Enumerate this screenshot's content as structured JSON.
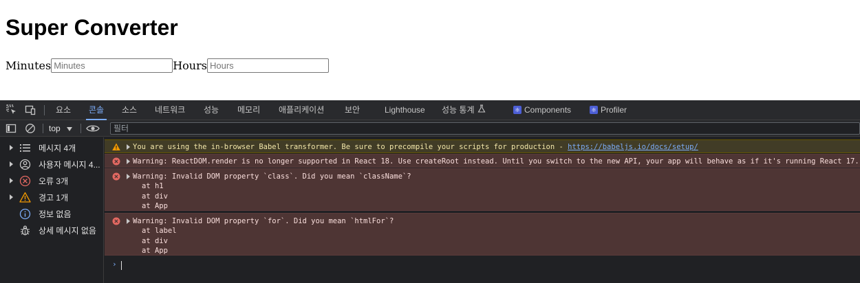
{
  "page": {
    "title": "Super Converter",
    "minutes_label": "Minutes",
    "minutes_placeholder": "Minutes",
    "hours_label": "Hours",
    "hours_placeholder": "Hours"
  },
  "devtools": {
    "tabs": [
      {
        "label": "요소"
      },
      {
        "label": "콘솔",
        "active": true
      },
      {
        "label": "소스"
      },
      {
        "label": "네트워크"
      },
      {
        "label": "성능"
      },
      {
        "label": "메모리"
      },
      {
        "label": "애플리케이션"
      },
      {
        "label": "보안"
      },
      {
        "label": "Lighthouse"
      },
      {
        "label": "성능 통계"
      },
      {
        "label": "Components"
      },
      {
        "label": "Profiler"
      }
    ],
    "toolbar": {
      "context": "top",
      "filter_placeholder": "필터"
    },
    "sidebar": [
      {
        "label": "메시지 4개",
        "icon": "list-icon"
      },
      {
        "label": "사용자 메시지 4...",
        "icon": "user-icon"
      },
      {
        "label": "오류 3개",
        "icon": "error-icon"
      },
      {
        "label": "경고 1개",
        "icon": "warning-icon"
      },
      {
        "label": "정보 없음",
        "icon": "info-icon"
      },
      {
        "label": "상세 메시지 없음",
        "icon": "bug-icon"
      }
    ],
    "messages": [
      {
        "level": "warning",
        "text": "You are using the in-browser Babel transformer. Be sure to precompile your scripts for production - ",
        "link": "https://babeljs.io/docs/setup/"
      },
      {
        "level": "error",
        "text": "Warning: ReactDOM.render is no longer supported in React 18. Use createRoot instead. Until you switch to the new API, your app will behave as if it's running React 17."
      },
      {
        "level": "error",
        "text": "Warning: Invalid DOM property `class`. Did you mean `className`?",
        "stack": [
          "at h1",
          "at div",
          "at App"
        ]
      },
      {
        "level": "error",
        "text": "Warning: Invalid DOM property `for`. Did you mean `htmlFor`?",
        "stack": [
          "at label",
          "at div",
          "at App"
        ]
      }
    ],
    "prompt": "›",
    "colors": {
      "panel_bg": "#202124",
      "toolbar_bg": "#292a2d",
      "accent": "#7cacf8",
      "warn_bg": "#413c26",
      "error_bg": "#4e3534",
      "error_icon": "#e46962",
      "warn_icon": "#f29900"
    }
  }
}
